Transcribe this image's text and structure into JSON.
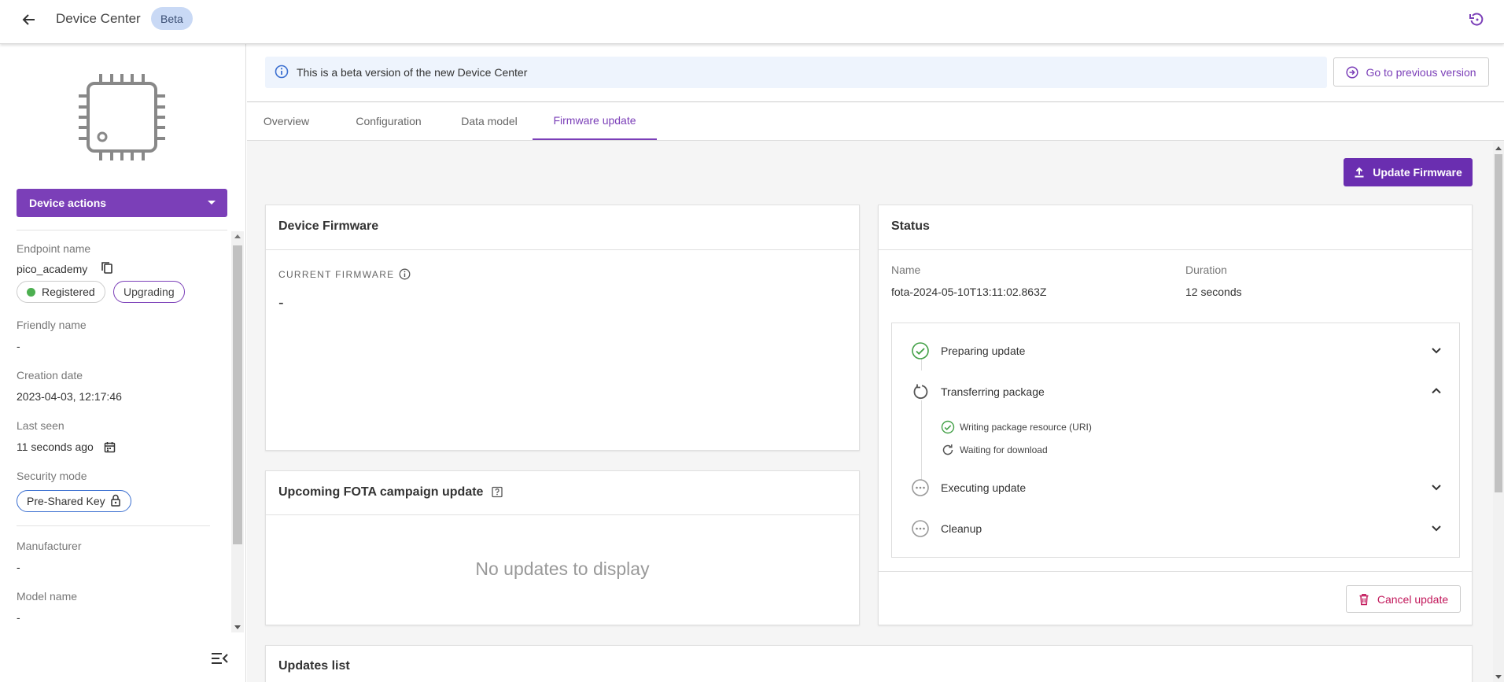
{
  "header": {
    "title": "Device Center",
    "badge": "Beta"
  },
  "sidebar": {
    "device_actions_label": "Device actions",
    "fields": {
      "endpoint_label": "Endpoint name",
      "endpoint_value": "pico_academy",
      "status_registered": "Registered",
      "status_upgrading": "Upgrading",
      "friendly_label": "Friendly name",
      "friendly_value": "-",
      "creation_label": "Creation date",
      "creation_value": "2023-04-03, 12:17:46",
      "last_seen_label": "Last seen",
      "last_seen_value": "11 seconds ago",
      "security_label": "Security mode",
      "security_value": "Pre-Shared Key",
      "manufacturer_label": "Manufacturer",
      "manufacturer_value": "-",
      "model_label": "Model name",
      "model_value": "-"
    }
  },
  "banner": {
    "text": "This is a beta version of the new Device Center",
    "prev_version_label": "Go to previous version"
  },
  "tabs": [
    {
      "label": "Overview"
    },
    {
      "label": "Configuration"
    },
    {
      "label": "Data model"
    },
    {
      "label": "Firmware update"
    }
  ],
  "active_tab": "Firmware update",
  "actions": {
    "update_firmware_label": "Update Firmware",
    "cancel_update_label": "Cancel update"
  },
  "device_firmware": {
    "title": "Device Firmware",
    "current_label": "CURRENT FIRMWARE",
    "current_value": "-"
  },
  "fota": {
    "title": "Upcoming FOTA campaign update",
    "empty_text": "No updates to display"
  },
  "status": {
    "title": "Status",
    "name_label": "Name",
    "name_value": "fota-2024-05-10T13:11:02.863Z",
    "duration_label": "Duration",
    "duration_value": "12 seconds",
    "steps": [
      {
        "label": "Preparing update",
        "state": "done"
      },
      {
        "label": "Transferring package",
        "state": "in-progress",
        "substeps": [
          {
            "label": "Writing package resource (URI)",
            "state": "done"
          },
          {
            "label": "Waiting for download",
            "state": "in-progress"
          }
        ]
      },
      {
        "label": "Executing update",
        "state": "pending"
      },
      {
        "label": "Cleanup",
        "state": "pending"
      }
    ]
  },
  "updates_list": {
    "title": "Updates list"
  },
  "colors": {
    "accent": "#7b3fb8",
    "success": "#43a047",
    "danger": "#c2185b",
    "banner_bg": "#eef4fd"
  }
}
